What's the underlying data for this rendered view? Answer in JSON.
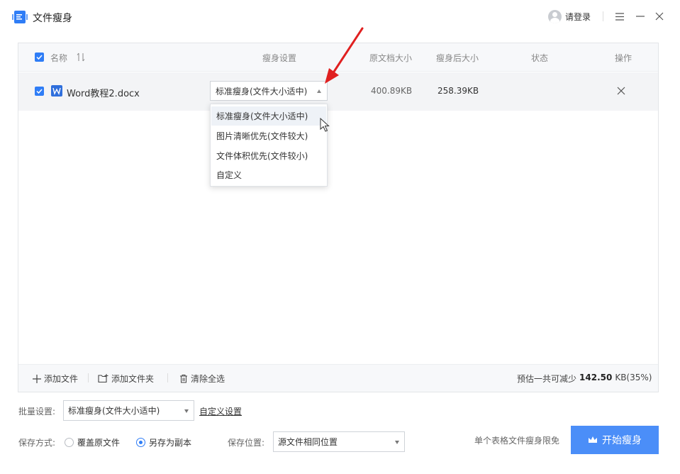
{
  "app": {
    "title": "文件瘦身"
  },
  "header": {
    "login_label": "请登录"
  },
  "table": {
    "columns": {
      "name": "名称",
      "setting": "瘦身设置",
      "original_size": "原文档大小",
      "slim_size": "瘦身后大小",
      "status": "状态",
      "action": "操作"
    },
    "rows": [
      {
        "file_name": "Word教程2.docx",
        "setting": "标准瘦身(文件大小适中)",
        "original_size": "400.89KB",
        "slim_size": "258.39KB",
        "status": ""
      }
    ]
  },
  "dropdown": {
    "options": [
      "标准瘦身(文件大小适中)",
      "图片清晰优先(文件较大)",
      "文件体积优先(文件较小)",
      "自定义"
    ],
    "highlighted_index": 0
  },
  "footer": {
    "add_file": "添加文件",
    "add_folder": "添加文件夹",
    "clear_all": "清除全选",
    "estimate_prefix": "预估一共可减少",
    "estimate_value": "142.50",
    "estimate_suffix": "KB(35%)"
  },
  "batch": {
    "label": "批量设置:",
    "value": "标准瘦身(文件大小适中)",
    "custom_link": "自定义设置"
  },
  "save": {
    "mode_label": "保存方式:",
    "option_overwrite": "覆盖原文件",
    "option_copy": "另存为副本",
    "selected": "copy",
    "location_label": "保存位置:",
    "location_value": "源文件相同位置"
  },
  "promo": "单个表格文件瘦身限免",
  "start_button": "开始瘦身",
  "colors": {
    "accent": "#2f7df6",
    "button": "#4b8ef8",
    "arrow": "#e02020"
  }
}
